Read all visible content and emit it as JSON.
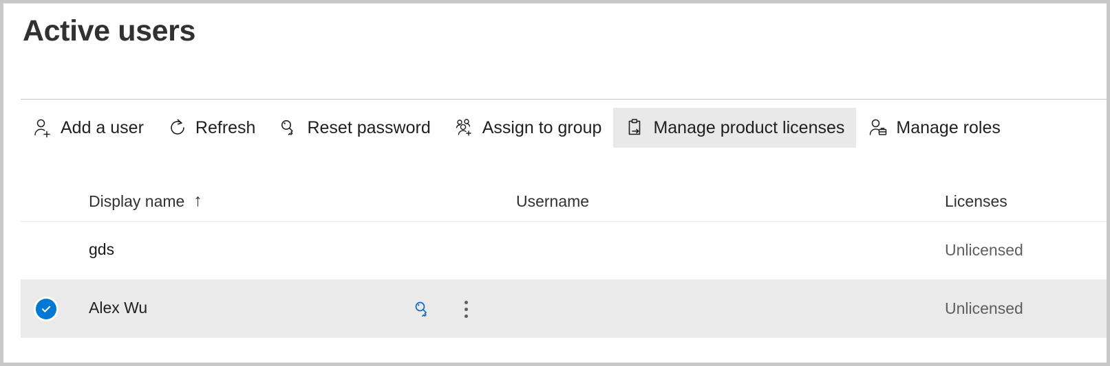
{
  "page": {
    "title": "Active users"
  },
  "command_bar": {
    "buttons": [
      {
        "label": "Add a user",
        "icon": "add-user-icon",
        "hovered": false
      },
      {
        "label": "Refresh",
        "icon": "refresh-icon",
        "hovered": false
      },
      {
        "label": "Reset password",
        "icon": "key-icon",
        "hovered": false
      },
      {
        "label": "Assign to group",
        "icon": "assign-to-group-icon",
        "hovered": false
      },
      {
        "label": "Manage product licenses",
        "icon": "clipboard-arrow-icon",
        "hovered": true
      },
      {
        "label": "Manage roles",
        "icon": "user-briefcase-icon",
        "hovered": false
      }
    ]
  },
  "table": {
    "columns": [
      {
        "key": "display_name",
        "label": "Display name",
        "sort": "ascending",
        "sort_glyph": "↑"
      },
      {
        "key": "username",
        "label": "Username",
        "sort": "none",
        "sort_glyph": ""
      },
      {
        "key": "licenses",
        "label": "Licenses",
        "sort": "none",
        "sort_glyph": ""
      }
    ],
    "rows": [
      {
        "display_name": "gds",
        "username": "",
        "licenses": "Unlicensed",
        "selected": false,
        "actions": []
      },
      {
        "display_name": "Alex Wu",
        "username": "",
        "licenses": "Unlicensed",
        "selected": true,
        "actions": [
          {
            "name": "reset-password-icon",
            "label": "Reset password"
          },
          {
            "name": "more-options-icon",
            "label": "More options"
          }
        ]
      }
    ]
  },
  "colors": {
    "accent": "#0078d4",
    "title_text": "#323130",
    "body_text": "#201f1e",
    "secondary_text": "#605e5c",
    "selected_row_bg": "#eaeaea",
    "hover_bg": "#e9e9e9",
    "divider": "#c8c6c4",
    "row_divider": "#ebebeb",
    "page_bg": "#ffffff",
    "outer_frame": "#c8c8c8"
  }
}
